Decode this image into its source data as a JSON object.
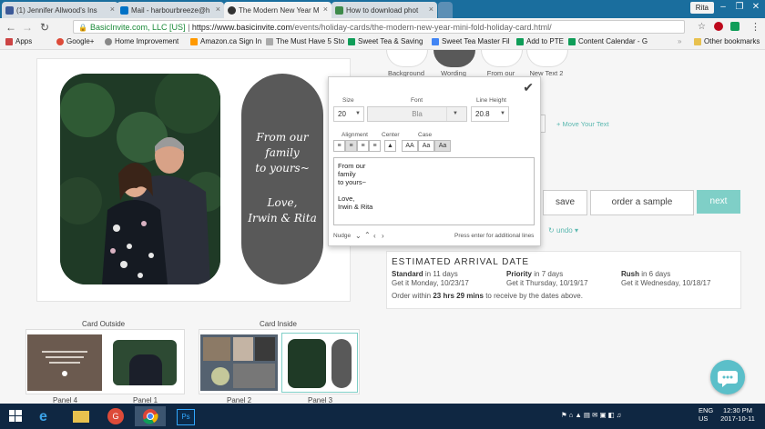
{
  "browser": {
    "tabs": [
      {
        "label": "(1) Jennifer Allwood's Ins",
        "favicon_color": "#3b5998"
      },
      {
        "label": "Mail - harbourbreeze@h",
        "favicon_color": "#0072c6"
      },
      {
        "label": "The Modern New Year M",
        "favicon_color": "#333333"
      },
      {
        "label": "How to download phot",
        "favicon_color": "#3d8a4a"
      }
    ],
    "user": "Rita",
    "secure_label": "BasicInvite.com, LLC [US]",
    "url_prefix": "https://www.basicinvite.com",
    "url_path": "/events/holiday-cards/the-modern-new-year-mini-fold-holiday-card.html/",
    "bookmarks": [
      "Apps",
      "Google+",
      "Home Improvement",
      "Amazon.ca Sign In",
      "The Must Have 5 Sto",
      "Sweet Tea & Saving",
      "Sweet Tea Master Fil",
      "Add to PTE",
      "Content Calendar - G"
    ],
    "other_bookmarks": "Other bookmarks"
  },
  "options": {
    "labels": [
      "Background",
      "Wording",
      "From our",
      "New Text 2"
    ],
    "move_text": "+ Move Your Text",
    "undo": "undo"
  },
  "card": {
    "panel_text_lines": [
      "From our",
      "family",
      "to yours~",
      "",
      "Love,",
      "Irwin & Rita"
    ]
  },
  "editor": {
    "size_label": "Size",
    "size_value": "20",
    "font_label": "Font",
    "font_value": "Bla",
    "line_height_label": "Line Height",
    "line_height_value": "20.8",
    "alignment_label": "Alignment",
    "center_label": "Center",
    "case_label": "Case",
    "case_buttons": [
      "AA",
      "Aa",
      "Aa"
    ],
    "text": "From our\nfamily\nto yours~\n\nLove,\nIrwin & Rita",
    "nudge_label": "Nudge",
    "hint": "Press enter for additional lines"
  },
  "actions": {
    "save": "save",
    "order": "order a sample",
    "next": "next"
  },
  "arrival": {
    "title": "ESTIMATED ARRIVAL DATE",
    "options": [
      {
        "name": "Standard",
        "when": "in 11 days",
        "date": "Get it Monday, 10/23/17"
      },
      {
        "name": "Priority",
        "when": "in 7 days",
        "date": "Get it Thursday, 10/19/17"
      },
      {
        "name": "Rush",
        "when": "in 6 days",
        "date": "Get it Wednesday, 10/18/17"
      }
    ],
    "order_prefix": "Order within",
    "order_time": "23 hrs 29 mins",
    "order_suffix": "to receive by the dates above."
  },
  "thumbnails": {
    "outside_label": "Card Outside",
    "inside_label": "Card Inside",
    "panels": [
      "Panel 4",
      "Panel 1",
      "Panel 2",
      "Panel 3"
    ]
  },
  "taskbar": {
    "language": "ENG",
    "region": "US",
    "time": "12:30 PM",
    "date": "2017-10-11"
  },
  "colors": {
    "accent": "#7fcfc7",
    "panel_gray": "#595959",
    "chat": "#5bbfc9"
  }
}
